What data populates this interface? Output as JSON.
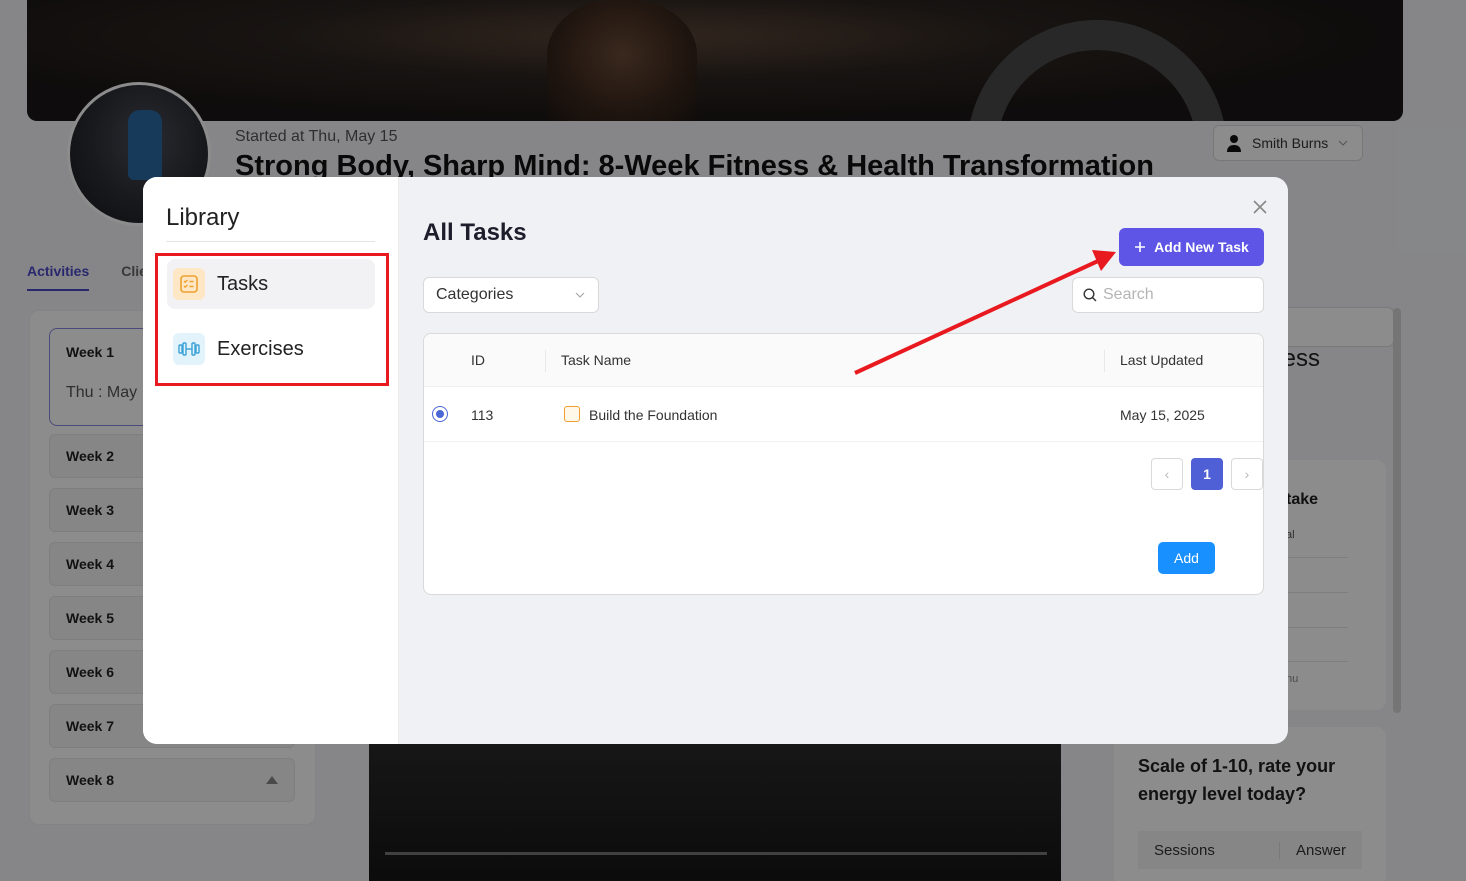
{
  "page": {
    "started_label": "Started at Thu, May 15",
    "program_title": "Strong Body, Sharp Mind: 8-Week Fitness & Health Transformation",
    "user_name": "Smith Burns",
    "tabs": [
      {
        "label": "Activities",
        "active": true
      },
      {
        "label": "Clie",
        "active": false
      }
    ],
    "weeks": [
      {
        "label": "Week 1",
        "date": "Thu : May"
      },
      {
        "label": "Week 2"
      },
      {
        "label": "Week 3"
      },
      {
        "label": "Week 4"
      },
      {
        "label": "Week 5"
      },
      {
        "label": "Week 6"
      },
      {
        "label": "Week 7"
      },
      {
        "label": "Week 8"
      }
    ],
    "progress_partial": "rogress",
    "side_card_title": "take",
    "side_card_sub": "al",
    "side_card_sub2": "nu",
    "question": "Scale of 1-10, rate your energy level today?",
    "question_table": {
      "col1": "Sessions",
      "col2": "Answer"
    }
  },
  "modal": {
    "library_title": "Library",
    "library_items": [
      {
        "label": "Tasks",
        "icon": "task-list-icon",
        "active": true
      },
      {
        "label": "Exercises",
        "icon": "dumbbell-icon",
        "active": false
      }
    ],
    "heading": "All Tasks",
    "add_new_task_label": "Add New Task",
    "categories_placeholder": "Categories",
    "search_placeholder": "Search",
    "table": {
      "columns": [
        "ID",
        "Task Name",
        "Last Updated"
      ],
      "rows": [
        {
          "selected": true,
          "id": "113",
          "name": "Build the Foundation",
          "updated": "May 15, 2025"
        }
      ]
    },
    "pagination": {
      "current": "1",
      "prev": "‹",
      "next": "›"
    },
    "add_label": "Add"
  },
  "colors": {
    "accent": "#5e55e6",
    "primary_blue": "#1890ff",
    "highlight_red": "#e8191f"
  }
}
